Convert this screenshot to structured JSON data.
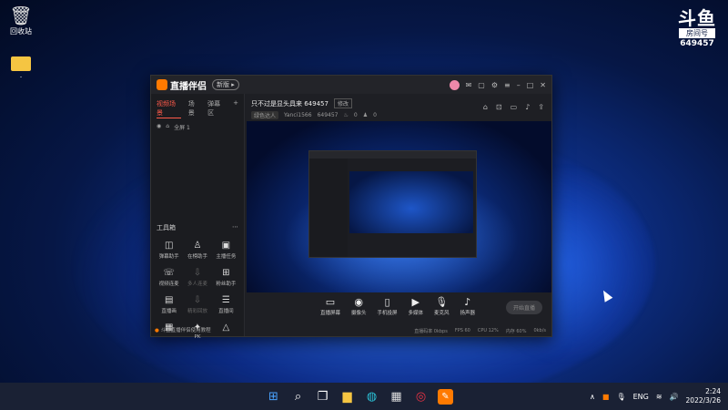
{
  "desktop": {
    "recycle_label": "回收站",
    "folder_label": "."
  },
  "watermark": {
    "logo": "斗鱼",
    "sub": "房间号",
    "room_number": "649457"
  },
  "window": {
    "brand": "直播伴侣",
    "version_pill": "新版 ▸",
    "sidebar": {
      "tabs": [
        "视频场景",
        "场景",
        "弹幕区"
      ],
      "scene_label": "全屏 1",
      "tools_title": "工具箱",
      "tools": [
        {
          "label": "弹幕助手",
          "icon": "◫",
          "dim": false
        },
        {
          "label": "在榜助手",
          "icon": "♙",
          "dim": false
        },
        {
          "label": "主播任务",
          "icon": "▣",
          "dim": false
        },
        {
          "label": "视频连麦",
          "icon": "☏",
          "dim": false
        },
        {
          "label": "多人连麦",
          "icon": "⇩",
          "dim": true
        },
        {
          "label": "粉丝助手",
          "icon": "⊞",
          "dim": false
        },
        {
          "label": "直播画",
          "icon": "▤",
          "dim": false
        },
        {
          "label": "精彩回放",
          "icon": "⇩",
          "dim": true
        },
        {
          "label": "直播间",
          "icon": "☰",
          "dim": false
        },
        {
          "label": "",
          "icon": "▦",
          "dim": false
        },
        {
          "label": "PK",
          "icon": "✦",
          "dim": false
        },
        {
          "label": "",
          "icon": "△",
          "dim": false
        }
      ],
      "tip": "斗鱼直播伴侣使用教程"
    },
    "main": {
      "title": "只不过是显头具来 649457",
      "modify": "修改",
      "tag": "绿色达人",
      "meta_user": "Yanci1566",
      "meta_id": "649457",
      "meta_hot": "0",
      "meta_fans": "0",
      "controls": [
        {
          "label": "直播屏幕",
          "icon": "▭"
        },
        {
          "label": "摄像头",
          "icon": "◉"
        },
        {
          "label": "手机投屏",
          "icon": "▯"
        },
        {
          "label": "多媒体",
          "icon": "▶"
        },
        {
          "label": "麦克风",
          "icon": "🎙"
        },
        {
          "label": "扬声器",
          "icon": "♪"
        }
      ],
      "start_btn": "开始直播",
      "status": [
        "直播码率 0kbps",
        "FPS 60",
        "CPU 12%",
        "内存 60%",
        "0kb/s"
      ]
    }
  },
  "taskbar": {
    "lang": "ENG",
    "time": "2:24",
    "date": "2022/3/26"
  }
}
